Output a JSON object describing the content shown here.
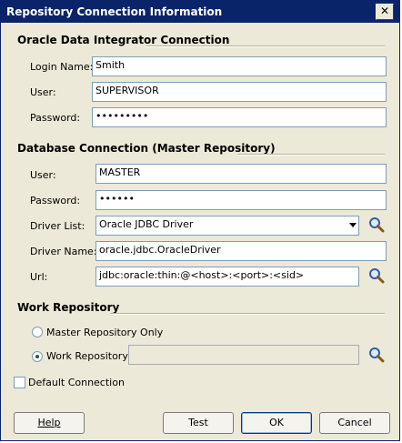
{
  "window": {
    "title": "Repository Connection Information",
    "close_glyph": "✕"
  },
  "odi": {
    "section_title": "Oracle Data Integrator Connection",
    "login_label": "Login Name:",
    "login_value": "Smith",
    "user_label": "User:",
    "user_value": "SUPERVISOR",
    "password_label": "Password:",
    "password_value": "•••••••••"
  },
  "db": {
    "section_title": "Database Connection (Master Repository)",
    "user_label": "User:",
    "user_value": "MASTER",
    "password_label": "Password:",
    "password_value": "••••••",
    "driver_list_label": "Driver List:",
    "driver_list_value": "Oracle JDBC Driver",
    "driver_name_label": "Driver Name:",
    "driver_name_value": "oracle.jdbc.OracleDriver",
    "url_label": "Url:",
    "url_value": "jdbc:oracle:thin:@<host>:<port>:<sid>"
  },
  "work": {
    "section_title": "Work Repository",
    "master_only_label": "Master Repository Only",
    "work_repo_label": "Work Repository",
    "work_repo_value": "",
    "selected": "work"
  },
  "default_connection": {
    "label": "Default Connection",
    "checked": false
  },
  "buttons": {
    "help": "Help",
    "test": "Test",
    "ok": "OK",
    "cancel": "Cancel"
  },
  "icons": {
    "search": "magnifier-icon",
    "dropdown": "chevron-down-icon",
    "close": "close-icon"
  },
  "colors": {
    "title_bar": "#0a246a",
    "dialog_bg": "#ece9d8",
    "field_border": "#7f9db9"
  }
}
